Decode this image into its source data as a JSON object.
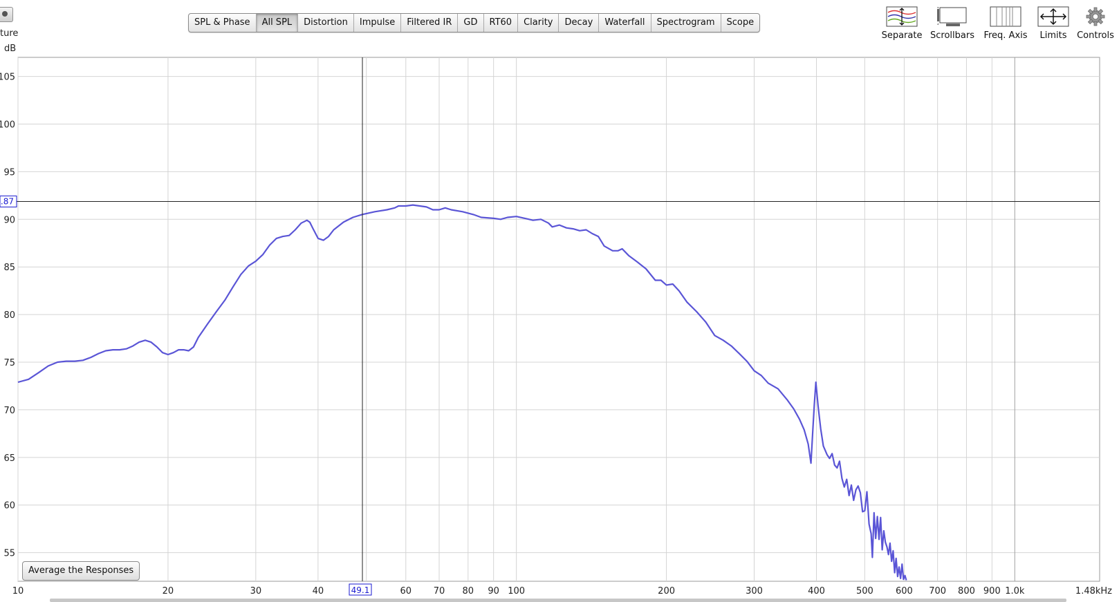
{
  "tabs": [
    {
      "label": "SPL & Phase",
      "active": false
    },
    {
      "label": "All SPL",
      "active": true
    },
    {
      "label": "Distortion",
      "active": false
    },
    {
      "label": "Impulse",
      "active": false
    },
    {
      "label": "Filtered IR",
      "active": false
    },
    {
      "label": "GD",
      "active": false
    },
    {
      "label": "RT60",
      "active": false
    },
    {
      "label": "Clarity",
      "active": false
    },
    {
      "label": "Decay",
      "active": false
    },
    {
      "label": "Waterfall",
      "active": false
    },
    {
      "label": "Spectrogram",
      "active": false
    },
    {
      "label": "Scope",
      "active": false
    }
  ],
  "toolbar": {
    "separate": "Separate",
    "scrollbars": "Scrollbars",
    "freq_axis": "Freq. Axis",
    "limits": "Limits",
    "controls": "Controls"
  },
  "left_panel": {
    "partial_label": "ture",
    "units_label": "dB"
  },
  "average_button": "Average the Responses",
  "cursor": {
    "x_readout": "49.1",
    "y_readout": ".87",
    "x_value": 49.1,
    "y_value": 91.87
  },
  "colors": {
    "trace": "#5a55d6",
    "grid": "#d4d4d4",
    "cursor": "#222222",
    "readout": "#1a1ad0"
  },
  "chart_data": {
    "type": "line",
    "x_scale": "log",
    "xlim": [
      10,
      1480
    ],
    "ylim": [
      52,
      107
    ],
    "grid": true,
    "x_ticks": [
      {
        "v": 10,
        "label": "10"
      },
      {
        "v": 20,
        "label": "20"
      },
      {
        "v": 30,
        "label": "30"
      },
      {
        "v": 40,
        "label": "40"
      },
      {
        "v": 50,
        "label": ""
      },
      {
        "v": 60,
        "label": "60"
      },
      {
        "v": 70,
        "label": "70"
      },
      {
        "v": 80,
        "label": "80"
      },
      {
        "v": 90,
        "label": "90"
      },
      {
        "v": 100,
        "label": "100"
      },
      {
        "v": 200,
        "label": "200"
      },
      {
        "v": 300,
        "label": "300"
      },
      {
        "v": 400,
        "label": "400"
      },
      {
        "v": 500,
        "label": "500"
      },
      {
        "v": 600,
        "label": "600"
      },
      {
        "v": 700,
        "label": "700"
      },
      {
        "v": 800,
        "label": "800"
      },
      {
        "v": 900,
        "label": "900"
      },
      {
        "v": 1000,
        "label": "1.0k"
      }
    ],
    "x_end_label": "1.48kHz",
    "y_ticks": [
      55,
      60,
      65,
      70,
      75,
      80,
      85,
      90,
      95,
      100,
      105
    ],
    "series": [
      {
        "color": "#5a55d6",
        "points": [
          [
            10,
            72.9
          ],
          [
            10.5,
            73.2
          ],
          [
            11,
            73.9
          ],
          [
            11.5,
            74.6
          ],
          [
            12,
            75.0
          ],
          [
            12.5,
            75.1
          ],
          [
            13,
            75.1
          ],
          [
            13.5,
            75.2
          ],
          [
            14,
            75.5
          ],
          [
            14.5,
            75.9
          ],
          [
            15,
            76.2
          ],
          [
            15.5,
            76.3
          ],
          [
            16,
            76.3
          ],
          [
            16.5,
            76.4
          ],
          [
            17,
            76.7
          ],
          [
            17.5,
            77.1
          ],
          [
            18,
            77.3
          ],
          [
            18.5,
            77.1
          ],
          [
            19,
            76.6
          ],
          [
            19.5,
            76.0
          ],
          [
            20,
            75.8
          ],
          [
            20.5,
            76.0
          ],
          [
            21,
            76.3
          ],
          [
            21.5,
            76.3
          ],
          [
            22,
            76.2
          ],
          [
            22.5,
            76.6
          ],
          [
            23,
            77.6
          ],
          [
            24,
            79.0
          ],
          [
            25,
            80.3
          ],
          [
            26,
            81.5
          ],
          [
            27,
            82.9
          ],
          [
            28,
            84.2
          ],
          [
            29,
            85.1
          ],
          [
            30,
            85.6
          ],
          [
            31,
            86.3
          ],
          [
            32,
            87.3
          ],
          [
            33,
            88.0
          ],
          [
            34,
            88.2
          ],
          [
            35,
            88.3
          ],
          [
            36,
            88.9
          ],
          [
            37,
            89.6
          ],
          [
            38,
            89.9
          ],
          [
            38.5,
            89.7
          ],
          [
            39,
            89.1
          ],
          [
            40,
            88.0
          ],
          [
            41,
            87.8
          ],
          [
            42,
            88.2
          ],
          [
            43,
            88.9
          ],
          [
            45,
            89.7
          ],
          [
            47,
            90.2
          ],
          [
            49,
            90.5
          ],
          [
            52,
            90.8
          ],
          [
            55,
            91.0
          ],
          [
            57,
            91.2
          ],
          [
            58,
            91.4
          ],
          [
            60,
            91.4
          ],
          [
            62,
            91.5
          ],
          [
            64,
            91.4
          ],
          [
            66,
            91.3
          ],
          [
            68,
            91.0
          ],
          [
            70,
            91.0
          ],
          [
            72,
            91.2
          ],
          [
            74,
            91.0
          ],
          [
            78,
            90.8
          ],
          [
            82,
            90.5
          ],
          [
            85,
            90.2
          ],
          [
            90,
            90.1
          ],
          [
            93,
            90.0
          ],
          [
            96,
            90.2
          ],
          [
            100,
            90.3
          ],
          [
            104,
            90.1
          ],
          [
            108,
            89.9
          ],
          [
            112,
            90.0
          ],
          [
            116,
            89.6
          ],
          [
            118,
            89.2
          ],
          [
            122,
            89.4
          ],
          [
            126,
            89.1
          ],
          [
            130,
            89.0
          ],
          [
            134,
            88.8
          ],
          [
            138,
            88.9
          ],
          [
            142,
            88.5
          ],
          [
            146,
            88.2
          ],
          [
            150,
            87.2
          ],
          [
            156,
            86.7
          ],
          [
            160,
            86.7
          ],
          [
            163,
            86.9
          ],
          [
            168,
            86.2
          ],
          [
            175,
            85.5
          ],
          [
            182,
            84.8
          ],
          [
            190,
            83.6
          ],
          [
            195,
            83.6
          ],
          [
            200,
            83.1
          ],
          [
            206,
            83.2
          ],
          [
            212,
            82.5
          ],
          [
            220,
            81.3
          ],
          [
            230,
            80.3
          ],
          [
            240,
            79.2
          ],
          [
            250,
            77.8
          ],
          [
            260,
            77.3
          ],
          [
            270,
            76.7
          ],
          [
            280,
            75.9
          ],
          [
            290,
            75.1
          ],
          [
            300,
            74.1
          ],
          [
            310,
            73.6
          ],
          [
            320,
            72.8
          ],
          [
            335,
            72.2
          ],
          [
            350,
            71.0
          ],
          [
            360,
            70.1
          ],
          [
            370,
            69.0
          ],
          [
            378,
            67.9
          ],
          [
            385,
            66.4
          ],
          [
            390,
            64.4
          ],
          [
            393,
            67.5
          ],
          [
            396,
            70.5
          ],
          [
            399,
            72.9
          ],
          [
            403,
            70.4
          ],
          [
            408,
            68.0
          ],
          [
            413,
            66.2
          ],
          [
            420,
            65.3
          ],
          [
            425,
            64.9
          ],
          [
            430,
            65.4
          ],
          [
            435,
            64.2
          ],
          [
            440,
            63.9
          ],
          [
            445,
            64.6
          ],
          [
            450,
            62.8
          ],
          [
            455,
            61.9
          ],
          [
            460,
            62.7
          ],
          [
            465,
            61.0
          ],
          [
            470,
            62.1
          ],
          [
            475,
            60.5
          ],
          [
            480,
            61.6
          ],
          [
            485,
            62.0
          ],
          [
            490,
            61.3
          ],
          [
            495,
            59.3
          ],
          [
            500,
            59.4
          ],
          [
            505,
            61.4
          ],
          [
            510,
            58.0
          ],
          [
            515,
            57.0
          ],
          [
            518,
            54.5
          ],
          [
            522,
            59.2
          ],
          [
            526,
            56.5
          ],
          [
            530,
            58.8
          ],
          [
            534,
            56.4
          ],
          [
            538,
            58.7
          ],
          [
            542,
            55.3
          ],
          [
            546,
            57.3
          ],
          [
            550,
            56.1
          ],
          [
            554,
            55.6
          ],
          [
            558,
            54.8
          ],
          [
            562,
            56.0
          ],
          [
            566,
            54.1
          ],
          [
            570,
            55.2
          ],
          [
            574,
            52.9
          ],
          [
            578,
            54.4
          ],
          [
            582,
            52.5
          ],
          [
            586,
            53.5
          ],
          [
            590,
            52.3
          ],
          [
            594,
            53.8
          ],
          [
            598,
            52.2
          ],
          [
            602,
            52.6
          ],
          [
            606,
            52.1
          ]
        ]
      }
    ]
  }
}
